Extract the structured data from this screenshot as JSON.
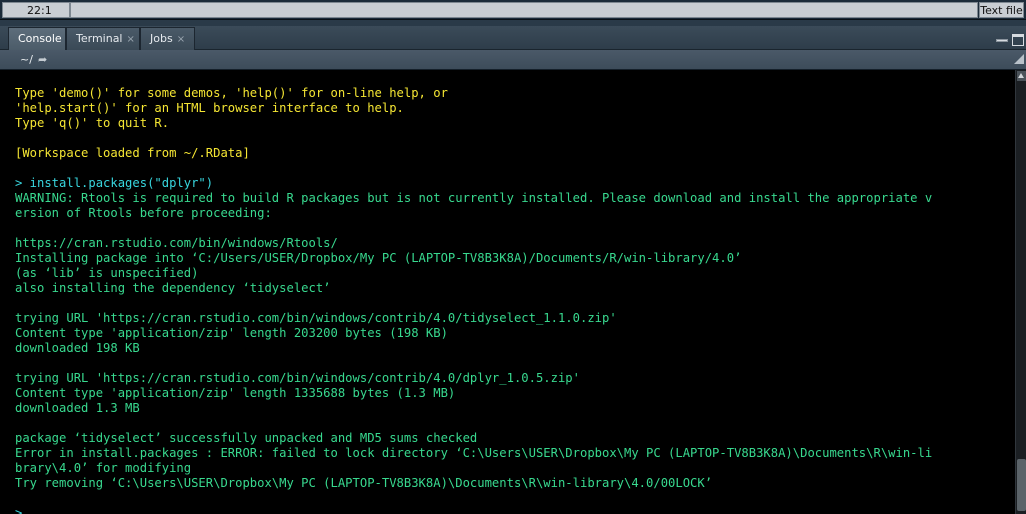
{
  "status": {
    "cursor_position": "22:1",
    "file_type": "Text file"
  },
  "tabs": [
    {
      "label": "Console",
      "active": true,
      "closable": false
    },
    {
      "label": "Terminal",
      "active": false,
      "closable": true
    },
    {
      "label": "Jobs",
      "active": false,
      "closable": true
    }
  ],
  "tab_close_glyph": "×",
  "path": {
    "current_dir": "~/",
    "go_icon": "arrow-go-icon"
  },
  "colors": {
    "yellow": "#f5e633",
    "cyan": "#38d6de",
    "green": "#38d98f",
    "background": "#000000"
  },
  "console": {
    "lines": [
      {
        "text": "Type 'demo()' for some demos, 'help()' for on-line help, or",
        "style": "yellow"
      },
      {
        "text": "'help.start()' for an HTML browser interface to help.",
        "style": "yellow"
      },
      {
        "text": "Type 'q()' to quit R.",
        "style": "yellow"
      },
      {
        "text": "",
        "style": "yellow"
      },
      {
        "text": "[Workspace loaded from ~/.RData]",
        "style": "yellow"
      },
      {
        "text": "",
        "style": "yellow"
      },
      {
        "text": "> install.packages(\"dplyr\")",
        "style": "cyan"
      },
      {
        "text": "WARNING: Rtools is required to build R packages but is not currently installed. Please download and install the appropriate v",
        "style": "green"
      },
      {
        "text": "ersion of Rtools before proceeding:",
        "style": "green"
      },
      {
        "text": "",
        "style": "green"
      },
      {
        "text": "https://cran.rstudio.com/bin/windows/Rtools/",
        "style": "green"
      },
      {
        "text": "Installing package into ‘C:/Users/USER/Dropbox/My PC (LAPTOP-TV8B3K8A)/Documents/R/win-library/4.0’",
        "style": "green"
      },
      {
        "text": "(as ‘lib’ is unspecified)",
        "style": "green"
      },
      {
        "text": "also installing the dependency ‘tidyselect’",
        "style": "green"
      },
      {
        "text": "",
        "style": "green"
      },
      {
        "text": "trying URL 'https://cran.rstudio.com/bin/windows/contrib/4.0/tidyselect_1.1.0.zip'",
        "style": "green"
      },
      {
        "text": "Content type 'application/zip' length 203200 bytes (198 KB)",
        "style": "green"
      },
      {
        "text": "downloaded 198 KB",
        "style": "green"
      },
      {
        "text": "",
        "style": "green"
      },
      {
        "text": "trying URL 'https://cran.rstudio.com/bin/windows/contrib/4.0/dplyr_1.0.5.zip'",
        "style": "green"
      },
      {
        "text": "Content type 'application/zip' length 1335688 bytes (1.3 MB)",
        "style": "green"
      },
      {
        "text": "downloaded 1.3 MB",
        "style": "green"
      },
      {
        "text": "",
        "style": "green"
      },
      {
        "text": "package ‘tidyselect’ successfully unpacked and MD5 sums checked",
        "style": "green"
      },
      {
        "text": "Error in install.packages : ERROR: failed to lock directory ‘C:\\Users\\USER\\Dropbox\\My PC (LAPTOP-TV8B3K8A)\\Documents\\R\\win-li",
        "style": "green"
      },
      {
        "text": "brary\\4.0’ for modifying",
        "style": "green"
      },
      {
        "text": "Try removing ‘C:\\Users\\USER\\Dropbox\\My PC (LAPTOP-TV8B3K8A)\\Documents\\R\\win-library\\4.0/00LOCK’",
        "style": "green"
      },
      {
        "text": "",
        "style": "green"
      },
      {
        "text": ">",
        "style": "cyan"
      }
    ]
  }
}
